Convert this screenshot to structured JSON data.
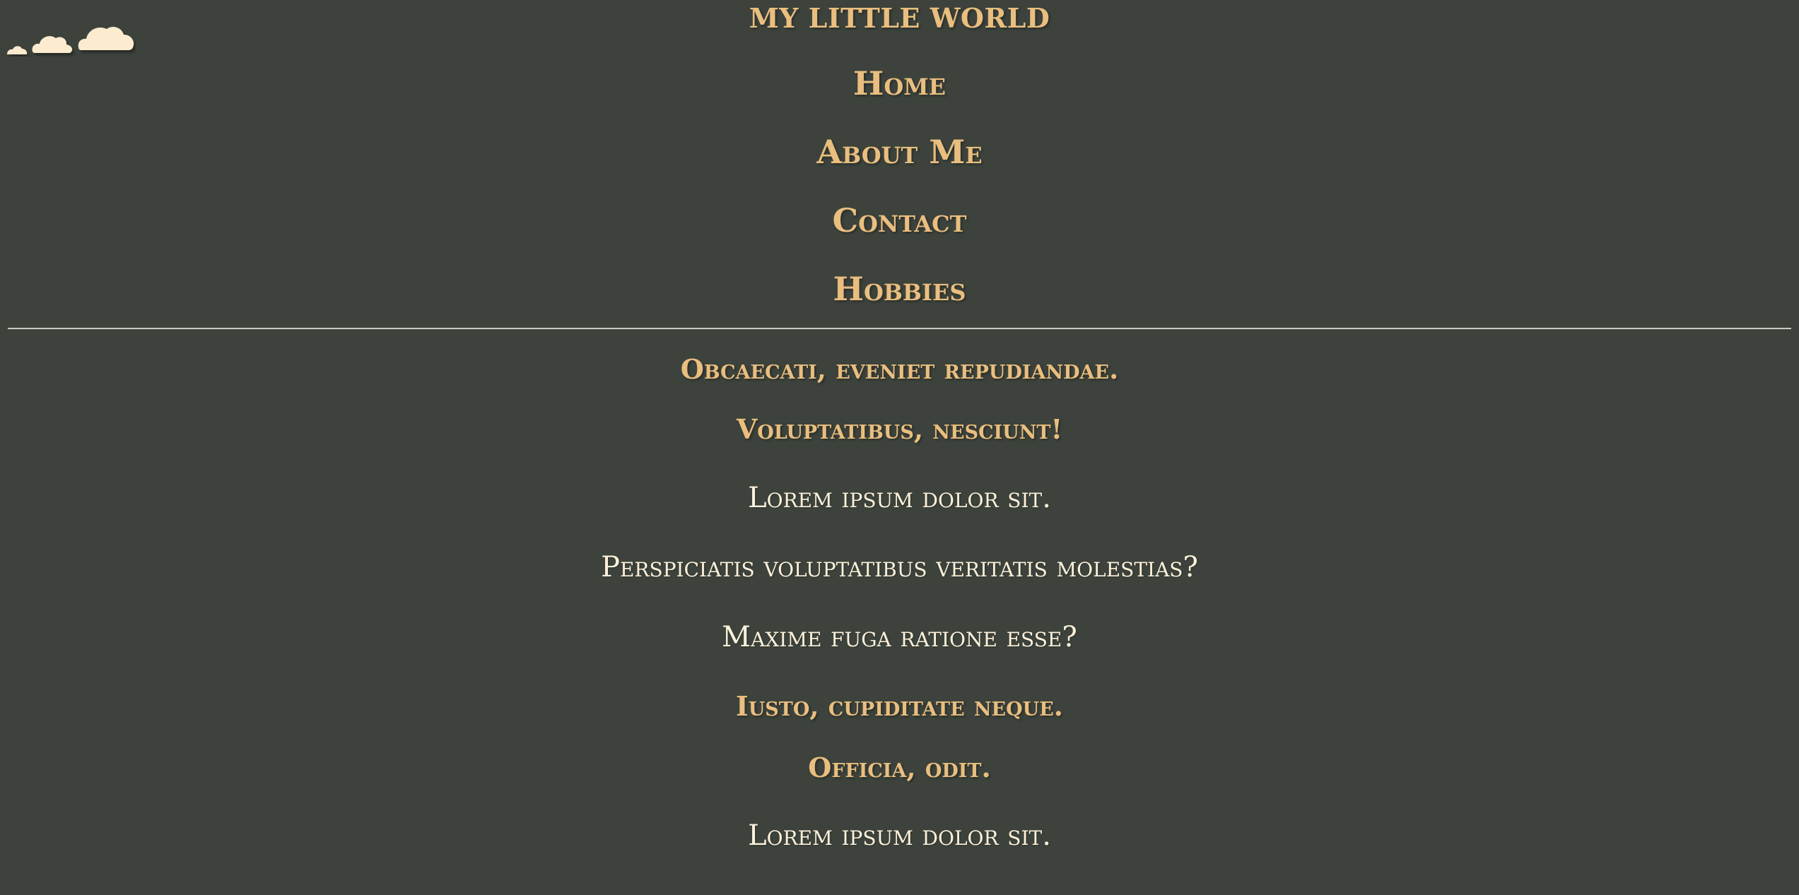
{
  "header": {
    "title": "MY LITTLE WORLD",
    "logo_icon": "clouds-icon"
  },
  "nav": {
    "items": [
      {
        "label": "Home"
      },
      {
        "label": "About Me"
      },
      {
        "label": "Contact"
      },
      {
        "label": "Hobbies"
      }
    ]
  },
  "content": {
    "blocks": [
      {
        "type": "heading",
        "text": "Obcaecati, eveniet repudiandae."
      },
      {
        "type": "heading",
        "text": "Voluptatibus, nesciunt!"
      },
      {
        "type": "paragraph",
        "text": "Lorem ipsum dolor sit."
      },
      {
        "type": "paragraph",
        "text": "Perspiciatis voluptatibus veritatis molestias?"
      },
      {
        "type": "paragraph",
        "text": "Maxime fuga ratione esse?"
      },
      {
        "type": "heading",
        "text": "Iusto, cupiditate neque."
      },
      {
        "type": "heading",
        "text": "Officia, odit."
      },
      {
        "type": "paragraph",
        "text": "Lorem ipsum dolor sit."
      }
    ]
  },
  "colors": {
    "background": "#3d433c",
    "accent": "#e9be7f",
    "text_light": "#fdf1db",
    "cloud": "#fdebd0",
    "divider": "#c9cbc5"
  }
}
